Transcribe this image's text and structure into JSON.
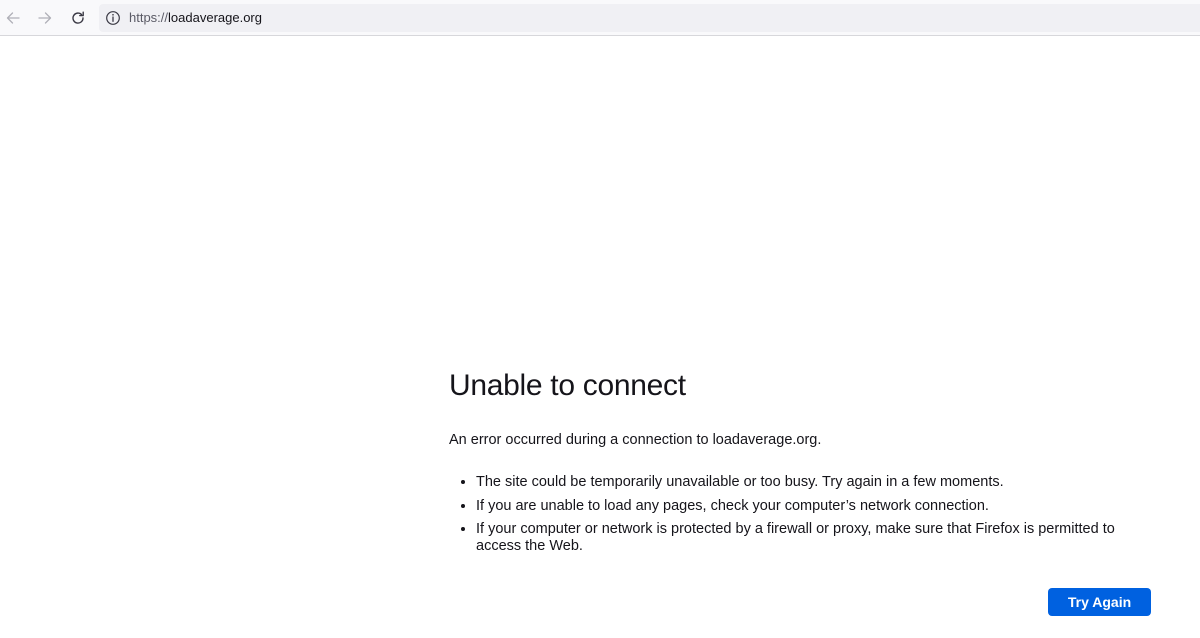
{
  "toolbar": {
    "back_icon": "arrow-left-icon",
    "forward_icon": "arrow-right-icon",
    "reload_icon": "reload-icon",
    "site_info_icon": "info-icon",
    "url_scheme": "https://",
    "url_host": "loadaverage.org"
  },
  "error": {
    "title": "Unable to connect",
    "description": "An error occurred during a connection to loadaverage.org.",
    "suggestions": [
      "The site could be temporarily unavailable or too busy. Try again in a few moments.",
      "If you are unable to load any pages, check your computer’s network connection.",
      "If your computer or network is protected by a firewall or proxy, make sure that Firefox is permitted to access the Web."
    ],
    "try_again_label": "Try Again"
  },
  "colors": {
    "accent": "#0061e0",
    "toolbar_background": "#f9f9fb",
    "urlbar_background": "#f0f0f4",
    "text": "#15141a",
    "disabled_icon": "#b0b0b8"
  }
}
